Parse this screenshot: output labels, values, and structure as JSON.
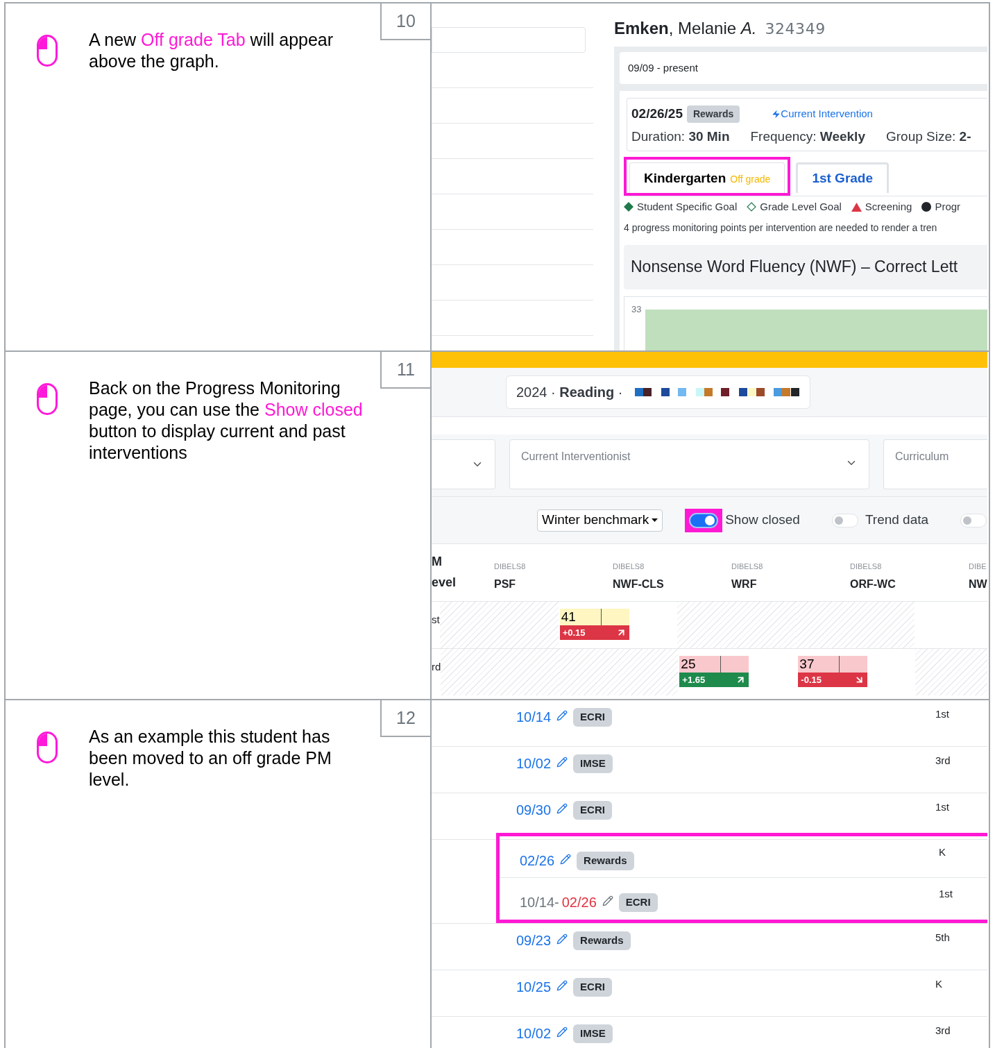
{
  "steps": [
    {
      "number": "10",
      "parts": [
        {
          "text": "A new ",
          "highlight": false
        },
        {
          "text": "Off grade Tab",
          "highlight": true
        },
        {
          "text": " will appear above the graph.",
          "highlight": false
        }
      ],
      "screen": {
        "kind": "chart_view",
        "student": "**Emken**, Melanie *A.*",
        "student_id": "324349",
        "period": "09/09 - present",
        "date": "02/26/25",
        "badge": "Rewards",
        "current": "Current Intervention",
        "details": [
          "Duration: **30 Min**",
          "Frequency: **Weekly**",
          "Group Size: **2-**"
        ],
        "tabs": [
          {
            "label": "Kindergarten",
            "tag": "Off grade",
            "selected": true,
            "highlighted": true
          },
          {
            "label": "1st Grade",
            "selected": false,
            "highlighted": false
          }
        ],
        "legend": [
          {
            "kind": "diamond",
            "label": "Student Specific Goal"
          },
          {
            "kind": "diamond-outline",
            "label": "Grade Level Goal"
          },
          {
            "kind": "triangle",
            "label": "Screening"
          },
          {
            "kind": "circle",
            "label": "Progr"
          }
        ],
        "note": "4 progress monitoring points per intervention are needed to render a tren",
        "chart_title": "Nonsense Word Fluency (NWF) – Correct Lett",
        "y_tick": "33"
      }
    },
    {
      "number": "11",
      "parts": [
        {
          "text": "Back on the Progress Monitoring page, you can use the ",
          "highlight": false
        },
        {
          "text": "Show closed",
          "highlight": true
        },
        {
          "text": " button to display current and past interventions",
          "highlight": false
        }
      ],
      "screen": {
        "kind": "monitoring_table",
        "heading": "2024 · **Reading** ·",
        "filters": [
          {
            "kind": "partial"
          },
          {
            "kind": "wide",
            "label": "Current Interventionist"
          },
          {
            "kind": "edge",
            "label": "Curriculum"
          }
        ],
        "benchmark": "Winter benchmark",
        "toggles": [
          {
            "label": "Show closed",
            "on": true,
            "highlighted": true
          },
          {
            "label": "Trend data",
            "on": false,
            "highlighted": false
          },
          {
            "on": false,
            "highlighted": false
          }
        ],
        "level_header": "M\nevel",
        "columns": [
          {
            "source": "DIBELS8",
            "name": "PSF"
          },
          {
            "source": "DIBELS8",
            "name": "NWF-CLS"
          },
          {
            "source": "DIBELS8",
            "name": "WRF"
          },
          {
            "source": "DIBELS8",
            "name": "ORF-WC"
          },
          {
            "source": "DIBE",
            "name": "NW"
          }
        ],
        "rows": [
          {
            "level": "st",
            "cells": [
              {
                "kind": "hatched"
              },
              {
                "kind": "score",
                "score": "41",
                "color": "#fff6c2",
                "change": "+0.15",
                "met": false,
                "rising": true
              },
              {
                "kind": "hatched"
              },
              {
                "kind": "hatched"
              },
              {
                "kind": "empty"
              }
            ]
          },
          {
            "level": "rd",
            "cells": [
              {
                "kind": "hatched"
              },
              {
                "kind": "hatched"
              },
              {
                "kind": "score",
                "score": "25",
                "color": "#f9c8cd",
                "change": "+1.65",
                "met": true,
                "rising": true
              },
              {
                "kind": "score",
                "score": "37",
                "color": "#f9c8cd",
                "change": "-0.15",
                "met": false,
                "rising": false
              },
              {
                "kind": "hatched"
              }
            ]
          }
        ]
      }
    },
    {
      "number": "12",
      "parts": [
        {
          "text": "As an example this student has been moved to an off grade PM level.",
          "highlight": false
        }
      ],
      "screen": {
        "kind": "intervention_list",
        "rows": [
          {
            "date": "10/14",
            "badge": "ECRI",
            "level": "1st",
            "closed": false,
            "highlighted": false
          },
          {
            "date": "10/02",
            "badge": "IMSE",
            "level": "3rd",
            "closed": false,
            "highlighted": false
          },
          {
            "date": "09/30",
            "badge": "ECRI",
            "level": "1st",
            "closed": false,
            "highlighted": false
          },
          {
            "date": "02/26",
            "badge": "Rewards",
            "level": "K",
            "closed": false,
            "highlighted": true
          },
          {
            "date": "10/14-",
            "end": "02/26",
            "badge": "ECRI",
            "level": "1st",
            "closed": true,
            "highlighted": true
          },
          {
            "date": "09/23",
            "badge": "Rewards",
            "level": "5th",
            "closed": false,
            "highlighted": false
          },
          {
            "date": "10/25",
            "badge": "ECRI",
            "level": "K",
            "closed": false,
            "highlighted": false
          },
          {
            "date": "10/02",
            "badge": "IMSE",
            "level": "3rd",
            "closed": false,
            "highlighted": false
          }
        ]
      }
    }
  ]
}
